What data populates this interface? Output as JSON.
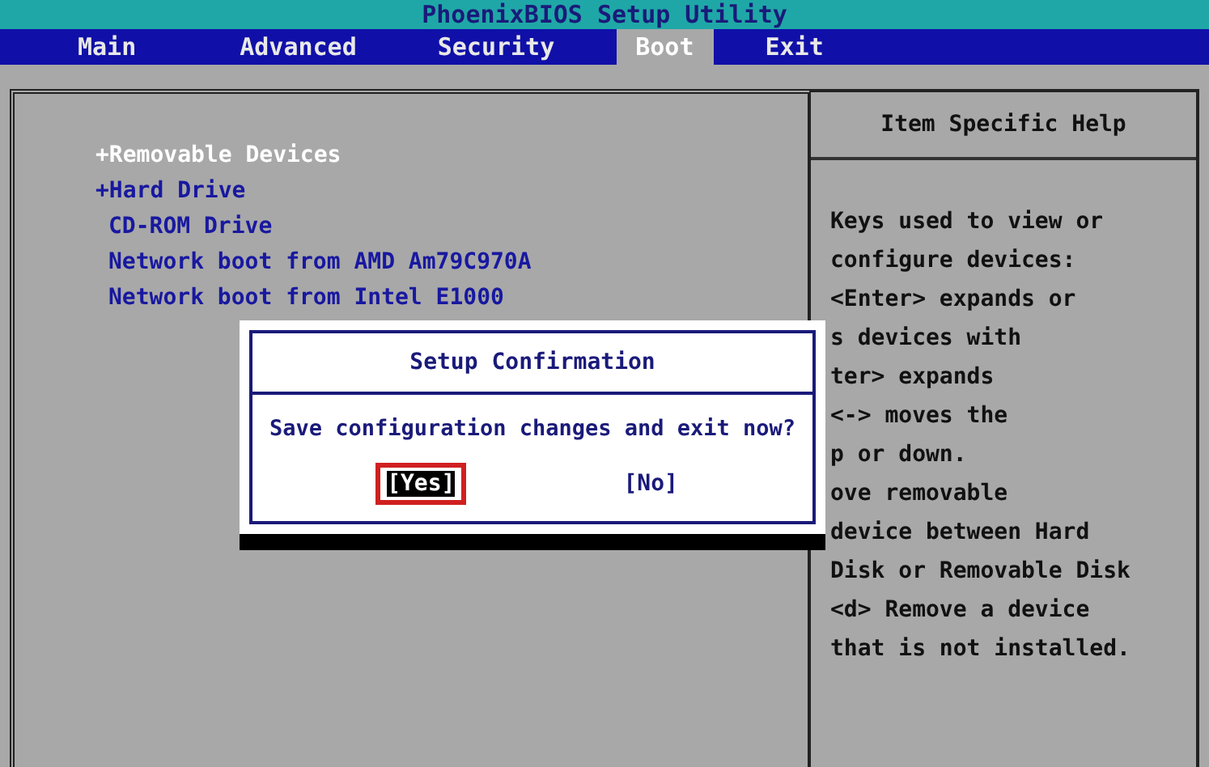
{
  "title": "PhoenixBIOS Setup Utility",
  "menu": [
    {
      "label": "Main",
      "selected": false
    },
    {
      "label": "Advanced",
      "selected": false
    },
    {
      "label": "Security",
      "selected": false
    },
    {
      "label": "Boot",
      "selected": true
    },
    {
      "label": "Exit",
      "selected": false
    }
  ],
  "boot_items": [
    {
      "label": "+Removable Devices",
      "selected": true
    },
    {
      "label": "+Hard Drive",
      "selected": false
    },
    {
      "label": "CD-ROM Drive",
      "selected": false
    },
    {
      "label": "Network boot from AMD Am79C970A",
      "selected": false
    },
    {
      "label": "Network boot from Intel E1000",
      "selected": false
    }
  ],
  "help": {
    "title": "Item Specific Help",
    "lines": [
      "Keys used to view or",
      "configure devices:",
      "<Enter> expands or",
      "s devices with",
      "ter> expands",
      "<-> moves the",
      "p or down.",
      "ove removable",
      "device between Hard",
      "Disk or Removable Disk",
      "<d> Remove a device",
      "that is not installed."
    ]
  },
  "dialog": {
    "title": "Setup Confirmation",
    "message": "Save configuration changes and exit now?",
    "buttons": [
      {
        "label": "[Yes]",
        "selected": true
      },
      {
        "label": "[No]",
        "selected": false
      }
    ]
  }
}
